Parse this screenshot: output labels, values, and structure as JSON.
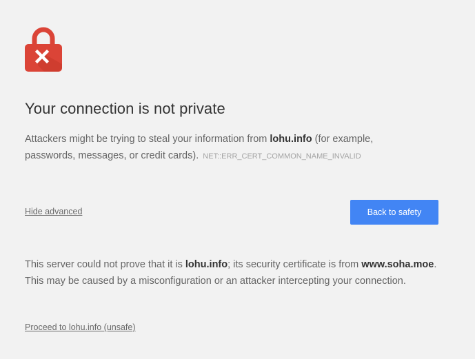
{
  "heading": "Your connection is not private",
  "explanation": {
    "prefix": "Attackers might be trying to steal your information from ",
    "domain": "lohu.info",
    "suffix": " (for example, passwords, messages, or credit cards).",
    "error_code": "NET::ERR_CERT_COMMON_NAME_INVALID"
  },
  "hide_advanced_label": "Hide advanced",
  "back_button_label": "Back to safety",
  "details": {
    "part1": "This server could not prove that it is ",
    "domain": "lohu.info",
    "part2": "; its security certificate is from ",
    "issuer": "www.soha.moe",
    "part3": ". This may be caused by a misconfiguration or an attacker intercepting your connection."
  },
  "proceed_link_label": "Proceed to lohu.info (unsafe)",
  "colors": {
    "lock_red": "#db4437",
    "button_blue": "#4285f4",
    "background": "#f2f2f2"
  },
  "icons": {
    "lock": "lock-error-icon"
  }
}
